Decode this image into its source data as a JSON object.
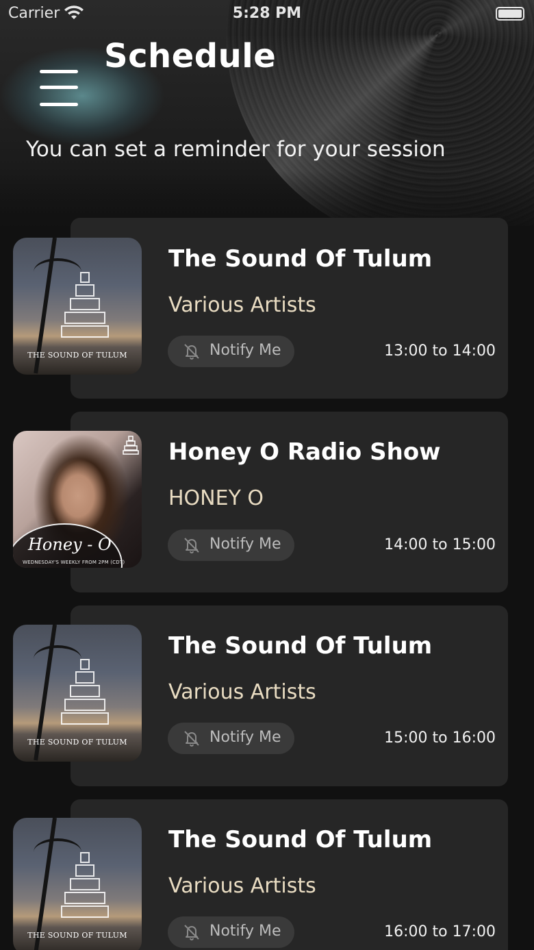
{
  "status_bar": {
    "carrier": "Carrier",
    "time": "5:28 PM",
    "wifi_icon": "wifi-icon",
    "battery_icon": "battery-full-icon"
  },
  "header": {
    "menu_icon": "hamburger-menu-icon",
    "title": "Schedule",
    "subtitle": "You can set a reminder for your session"
  },
  "schedule": [
    {
      "title": "The Sound Of Tulum",
      "artist": "Various Artists",
      "notify_label": "Notify Me",
      "time": "13:00 to 14:00",
      "cover_caption": "THE SOUND OF TULUM"
    },
    {
      "title": "Honey O Radio Show",
      "artist": "HONEY O",
      "notify_label": "Notify Me",
      "time": "14:00 to 15:00",
      "cover_script": "Honey - O",
      "cover_tag": "WEDNESDAY'S WEEKLY FROM 2PM (CDT)"
    },
    {
      "title": "The Sound Of Tulum",
      "artist": "Various Artists",
      "notify_label": "Notify Me",
      "time": "15:00 to 16:00",
      "cover_caption": "THE SOUND OF TULUM"
    },
    {
      "title": "The Sound Of Tulum",
      "artist": "Various Artists",
      "notify_label": "Notify Me",
      "time": "16:00 to 17:00",
      "cover_caption": "THE SOUND OF TULUM"
    }
  ],
  "colors": {
    "background": "#111111",
    "card": "#262626",
    "artist_text": "#e9dcc2",
    "notify_button": "#3a3a3a"
  }
}
